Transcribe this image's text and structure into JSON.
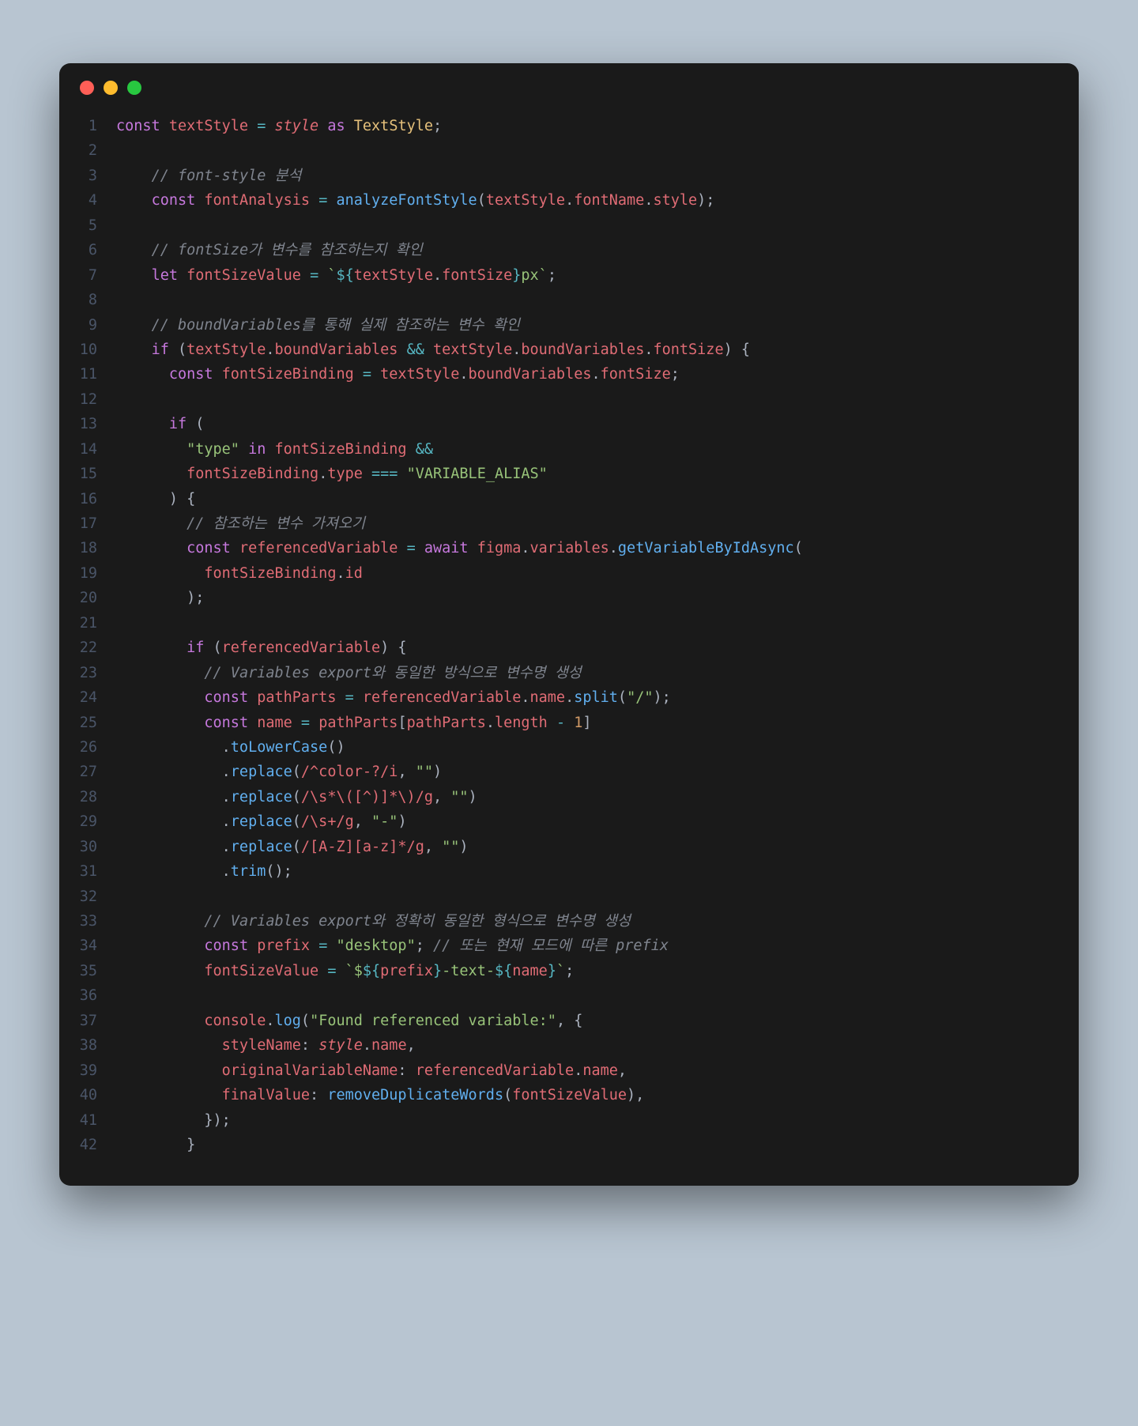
{
  "window": {
    "dots": [
      "close",
      "minimize",
      "zoom"
    ]
  },
  "lines": [
    {
      "n": 1,
      "tokens": [
        [
          "kw",
          "const "
        ],
        [
          "id",
          "textStyle"
        ],
        [
          "wt",
          " "
        ],
        [
          "op",
          "="
        ],
        [
          "wt",
          " "
        ],
        [
          "it",
          "style",
          "id"
        ],
        [
          "wt",
          " "
        ],
        [
          "kw",
          "as"
        ],
        [
          "wt",
          " "
        ],
        [
          "ty",
          "TextStyle"
        ],
        [
          "pn",
          ";"
        ]
      ]
    },
    {
      "n": 2,
      "tokens": []
    },
    {
      "n": 3,
      "tokens": [
        [
          "wt",
          "    "
        ],
        [
          "cm",
          "// font-style 분석"
        ]
      ]
    },
    {
      "n": 4,
      "tokens": [
        [
          "wt",
          "    "
        ],
        [
          "kw",
          "const "
        ],
        [
          "id",
          "fontAnalysis"
        ],
        [
          "wt",
          " "
        ],
        [
          "op",
          "="
        ],
        [
          "wt",
          " "
        ],
        [
          "fn",
          "analyzeFontStyle"
        ],
        [
          "pn",
          "("
        ],
        [
          "id",
          "textStyle"
        ],
        [
          "pn",
          "."
        ],
        [
          "pr",
          "fontName"
        ],
        [
          "pn",
          "."
        ],
        [
          "pr",
          "style"
        ],
        [
          "pn",
          ");"
        ]
      ]
    },
    {
      "n": 5,
      "tokens": []
    },
    {
      "n": 6,
      "tokens": [
        [
          "wt",
          "    "
        ],
        [
          "cm",
          "// fontSize가 변수를 참조하는지 확인"
        ]
      ]
    },
    {
      "n": 7,
      "tokens": [
        [
          "wt",
          "    "
        ],
        [
          "kw",
          "let "
        ],
        [
          "id",
          "fontSizeValue"
        ],
        [
          "wt",
          " "
        ],
        [
          "op",
          "="
        ],
        [
          "wt",
          " "
        ],
        [
          "str",
          "`"
        ],
        [
          "op",
          "${"
        ],
        [
          "id",
          "textStyle"
        ],
        [
          "pn",
          "."
        ],
        [
          "pr",
          "fontSize"
        ],
        [
          "op",
          "}"
        ],
        [
          "str",
          "px`"
        ],
        [
          "pn",
          ";"
        ]
      ]
    },
    {
      "n": 8,
      "tokens": []
    },
    {
      "n": 9,
      "tokens": [
        [
          "wt",
          "    "
        ],
        [
          "cm",
          "// boundVariables를 통해 실제 참조하는 변수 확인"
        ]
      ]
    },
    {
      "n": 10,
      "tokens": [
        [
          "wt",
          "    "
        ],
        [
          "kw",
          "if"
        ],
        [
          "wt",
          " "
        ],
        [
          "pn",
          "("
        ],
        [
          "id",
          "textStyle"
        ],
        [
          "pn",
          "."
        ],
        [
          "pr",
          "boundVariables"
        ],
        [
          "wt",
          " "
        ],
        [
          "op",
          "&&"
        ],
        [
          "wt",
          " "
        ],
        [
          "id",
          "textStyle"
        ],
        [
          "pn",
          "."
        ],
        [
          "pr",
          "boundVariables"
        ],
        [
          "pn",
          "."
        ],
        [
          "pr",
          "fontSize"
        ],
        [
          "pn",
          ") {"
        ]
      ]
    },
    {
      "n": 11,
      "tokens": [
        [
          "wt",
          "      "
        ],
        [
          "kw",
          "const "
        ],
        [
          "id",
          "fontSizeBinding"
        ],
        [
          "wt",
          " "
        ],
        [
          "op",
          "="
        ],
        [
          "wt",
          " "
        ],
        [
          "id",
          "textStyle"
        ],
        [
          "pn",
          "."
        ],
        [
          "pr",
          "boundVariables"
        ],
        [
          "pn",
          "."
        ],
        [
          "pr",
          "fontSize"
        ],
        [
          "pn",
          ";"
        ]
      ]
    },
    {
      "n": 12,
      "tokens": []
    },
    {
      "n": 13,
      "tokens": [
        [
          "wt",
          "      "
        ],
        [
          "kw",
          "if"
        ],
        [
          "wt",
          " "
        ],
        [
          "pn",
          "("
        ]
      ]
    },
    {
      "n": 14,
      "tokens": [
        [
          "wt",
          "        "
        ],
        [
          "str",
          "\"type\""
        ],
        [
          "wt",
          " "
        ],
        [
          "kw",
          "in"
        ],
        [
          "wt",
          " "
        ],
        [
          "id",
          "fontSizeBinding"
        ],
        [
          "wt",
          " "
        ],
        [
          "op",
          "&&"
        ]
      ]
    },
    {
      "n": 15,
      "tokens": [
        [
          "wt",
          "        "
        ],
        [
          "id",
          "fontSizeBinding"
        ],
        [
          "pn",
          "."
        ],
        [
          "pr",
          "type"
        ],
        [
          "wt",
          " "
        ],
        [
          "op",
          "==="
        ],
        [
          "wt",
          " "
        ],
        [
          "str",
          "\"VARIABLE_ALIAS\""
        ]
      ]
    },
    {
      "n": 16,
      "tokens": [
        [
          "wt",
          "      "
        ],
        [
          "pn",
          ") {"
        ]
      ]
    },
    {
      "n": 17,
      "tokens": [
        [
          "wt",
          "        "
        ],
        [
          "cm",
          "// 참조하는 변수 가져오기"
        ]
      ]
    },
    {
      "n": 18,
      "tokens": [
        [
          "wt",
          "        "
        ],
        [
          "kw",
          "const "
        ],
        [
          "id",
          "referencedVariable"
        ],
        [
          "wt",
          " "
        ],
        [
          "op",
          "="
        ],
        [
          "wt",
          " "
        ],
        [
          "kw",
          "await"
        ],
        [
          "wt",
          " "
        ],
        [
          "id",
          "figma"
        ],
        [
          "pn",
          "."
        ],
        [
          "pr",
          "variables"
        ],
        [
          "pn",
          "."
        ],
        [
          "fn",
          "getVariableByIdAsync"
        ],
        [
          "pn",
          "("
        ]
      ]
    },
    {
      "n": 19,
      "tokens": [
        [
          "wt",
          "          "
        ],
        [
          "id",
          "fontSizeBinding"
        ],
        [
          "pn",
          "."
        ],
        [
          "pr",
          "id"
        ]
      ]
    },
    {
      "n": 20,
      "tokens": [
        [
          "wt",
          "        "
        ],
        [
          "pn",
          ");"
        ]
      ]
    },
    {
      "n": 21,
      "tokens": []
    },
    {
      "n": 22,
      "tokens": [
        [
          "wt",
          "        "
        ],
        [
          "kw",
          "if"
        ],
        [
          "wt",
          " "
        ],
        [
          "pn",
          "("
        ],
        [
          "id",
          "referencedVariable"
        ],
        [
          "pn",
          ") {"
        ]
      ]
    },
    {
      "n": 23,
      "tokens": [
        [
          "wt",
          "          "
        ],
        [
          "cm",
          "// Variables export와 동일한 방식으로 변수명 생성"
        ]
      ]
    },
    {
      "n": 24,
      "tokens": [
        [
          "wt",
          "          "
        ],
        [
          "kw",
          "const "
        ],
        [
          "id",
          "pathParts"
        ],
        [
          "wt",
          " "
        ],
        [
          "op",
          "="
        ],
        [
          "wt",
          " "
        ],
        [
          "id",
          "referencedVariable"
        ],
        [
          "pn",
          "."
        ],
        [
          "pr",
          "name"
        ],
        [
          "pn",
          "."
        ],
        [
          "fn",
          "split"
        ],
        [
          "pn",
          "("
        ],
        [
          "str",
          "\"/\""
        ],
        [
          "pn",
          ");"
        ]
      ]
    },
    {
      "n": 25,
      "tokens": [
        [
          "wt",
          "          "
        ],
        [
          "kw",
          "const "
        ],
        [
          "id",
          "name"
        ],
        [
          "wt",
          " "
        ],
        [
          "op",
          "="
        ],
        [
          "wt",
          " "
        ],
        [
          "id",
          "pathParts"
        ],
        [
          "pn",
          "["
        ],
        [
          "id",
          "pathParts"
        ],
        [
          "pn",
          "."
        ],
        [
          "pr",
          "length"
        ],
        [
          "wt",
          " "
        ],
        [
          "op",
          "-"
        ],
        [
          "wt",
          " "
        ],
        [
          "num",
          "1"
        ],
        [
          "pn",
          "]"
        ]
      ]
    },
    {
      "n": 26,
      "tokens": [
        [
          "wt",
          "            "
        ],
        [
          "pn",
          "."
        ],
        [
          "fn",
          "toLowerCase"
        ],
        [
          "pn",
          "()"
        ]
      ]
    },
    {
      "n": 27,
      "tokens": [
        [
          "wt",
          "            "
        ],
        [
          "pn",
          "."
        ],
        [
          "fn",
          "replace"
        ],
        [
          "pn",
          "("
        ],
        [
          "rg",
          "/^color-?/i"
        ],
        [
          "pn",
          ", "
        ],
        [
          "str",
          "\"\""
        ],
        [
          "pn",
          ")"
        ]
      ]
    },
    {
      "n": 28,
      "tokens": [
        [
          "wt",
          "            "
        ],
        [
          "pn",
          "."
        ],
        [
          "fn",
          "replace"
        ],
        [
          "pn",
          "("
        ],
        [
          "rg",
          "/\\s*\\([^)]*\\)/g"
        ],
        [
          "pn",
          ", "
        ],
        [
          "str",
          "\"\""
        ],
        [
          "pn",
          ")"
        ]
      ]
    },
    {
      "n": 29,
      "tokens": [
        [
          "wt",
          "            "
        ],
        [
          "pn",
          "."
        ],
        [
          "fn",
          "replace"
        ],
        [
          "pn",
          "("
        ],
        [
          "rg",
          "/\\s+/g"
        ],
        [
          "pn",
          ", "
        ],
        [
          "str",
          "\"-\""
        ],
        [
          "pn",
          ")"
        ]
      ]
    },
    {
      "n": 30,
      "tokens": [
        [
          "wt",
          "            "
        ],
        [
          "pn",
          "."
        ],
        [
          "fn",
          "replace"
        ],
        [
          "pn",
          "("
        ],
        [
          "rg",
          "/[A-Z][a-z]*/g"
        ],
        [
          "pn",
          ", "
        ],
        [
          "str",
          "\"\""
        ],
        [
          "pn",
          ")"
        ]
      ]
    },
    {
      "n": 31,
      "tokens": [
        [
          "wt",
          "            "
        ],
        [
          "pn",
          "."
        ],
        [
          "fn",
          "trim"
        ],
        [
          "pn",
          "();"
        ]
      ]
    },
    {
      "n": 32,
      "tokens": []
    },
    {
      "n": 33,
      "tokens": [
        [
          "wt",
          "          "
        ],
        [
          "cm",
          "// Variables export와 정확히 동일한 형식으로 변수명 생성"
        ]
      ]
    },
    {
      "n": 34,
      "tokens": [
        [
          "wt",
          "          "
        ],
        [
          "kw",
          "const "
        ],
        [
          "id",
          "prefix"
        ],
        [
          "wt",
          " "
        ],
        [
          "op",
          "="
        ],
        [
          "wt",
          " "
        ],
        [
          "str",
          "\"desktop\""
        ],
        [
          "pn",
          "; "
        ],
        [
          "cm",
          "// 또는 현재 모드에 따른 prefix"
        ]
      ]
    },
    {
      "n": 35,
      "tokens": [
        [
          "wt",
          "          "
        ],
        [
          "id",
          "fontSizeValue"
        ],
        [
          "wt",
          " "
        ],
        [
          "op",
          "="
        ],
        [
          "wt",
          " "
        ],
        [
          "str",
          "`$"
        ],
        [
          "op",
          "${"
        ],
        [
          "id",
          "prefix"
        ],
        [
          "op",
          "}"
        ],
        [
          "str",
          "-text-"
        ],
        [
          "op",
          "${"
        ],
        [
          "id",
          "name"
        ],
        [
          "op",
          "}"
        ],
        [
          "str",
          "`"
        ],
        [
          "pn",
          ";"
        ]
      ]
    },
    {
      "n": 36,
      "tokens": []
    },
    {
      "n": 37,
      "tokens": [
        [
          "wt",
          "          "
        ],
        [
          "id",
          "console"
        ],
        [
          "pn",
          "."
        ],
        [
          "fn",
          "log"
        ],
        [
          "pn",
          "("
        ],
        [
          "str",
          "\"Found referenced variable:\""
        ],
        [
          "pn",
          ", {"
        ]
      ]
    },
    {
      "n": 38,
      "tokens": [
        [
          "wt",
          "            "
        ],
        [
          "pr",
          "styleName"
        ],
        [
          "pn",
          ": "
        ],
        [
          "it",
          "style",
          "id"
        ],
        [
          "pn",
          "."
        ],
        [
          "pr",
          "name"
        ],
        [
          "pn",
          ","
        ]
      ]
    },
    {
      "n": 39,
      "tokens": [
        [
          "wt",
          "            "
        ],
        [
          "pr",
          "originalVariableName"
        ],
        [
          "pn",
          ": "
        ],
        [
          "id",
          "referencedVariable"
        ],
        [
          "pn",
          "."
        ],
        [
          "pr",
          "name"
        ],
        [
          "pn",
          ","
        ]
      ]
    },
    {
      "n": 40,
      "tokens": [
        [
          "wt",
          "            "
        ],
        [
          "pr",
          "finalValue"
        ],
        [
          "pn",
          ": "
        ],
        [
          "fn",
          "removeDuplicateWords"
        ],
        [
          "pn",
          "("
        ],
        [
          "id",
          "fontSizeValue"
        ],
        [
          "pn",
          "),"
        ]
      ]
    },
    {
      "n": 41,
      "tokens": [
        [
          "wt",
          "          "
        ],
        [
          "pn",
          "});"
        ]
      ]
    },
    {
      "n": 42,
      "tokens": [
        [
          "wt",
          "        "
        ],
        [
          "pn",
          "}"
        ]
      ]
    }
  ]
}
